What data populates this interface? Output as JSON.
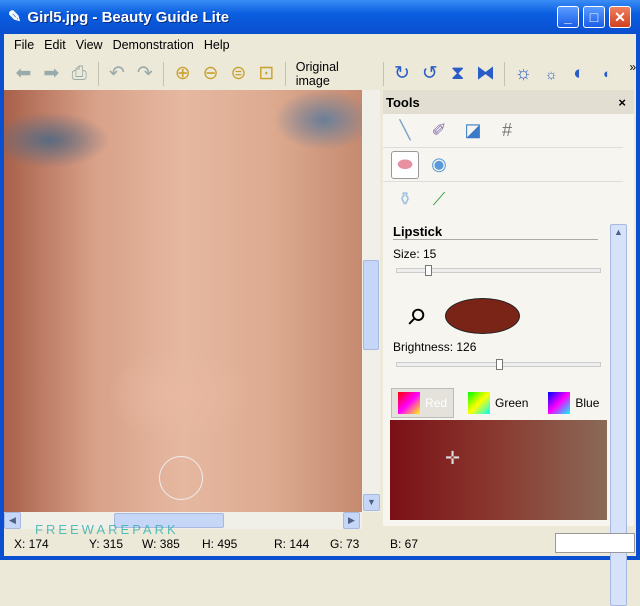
{
  "window": {
    "title": "Girl5.jpg - Beauty Guide Lite",
    "minimize": "_",
    "maximize": "□",
    "close": "✕"
  },
  "menu": [
    "File",
    "Edit",
    "View",
    "Demonstration",
    "Help"
  ],
  "toolbar": {
    "original_image": "Original image",
    "overflow": "»"
  },
  "tools": {
    "title": "Tools",
    "close": "×",
    "section": "Lipstick",
    "size_label": "Size: 15",
    "size": 15,
    "brightness_label": "Brightness: 126",
    "brightness": 126,
    "lipstick_color": "#7a2418",
    "tabs": [
      "Red",
      "Green",
      "Blue"
    ]
  },
  "status": {
    "x": "X: 174",
    "y": "Y: 315",
    "w": "W: 385",
    "h": "H: 495",
    "r": "R: 144",
    "g": "G: 73",
    "b": "B: 67"
  },
  "watermark": "FREEWAREPARK"
}
